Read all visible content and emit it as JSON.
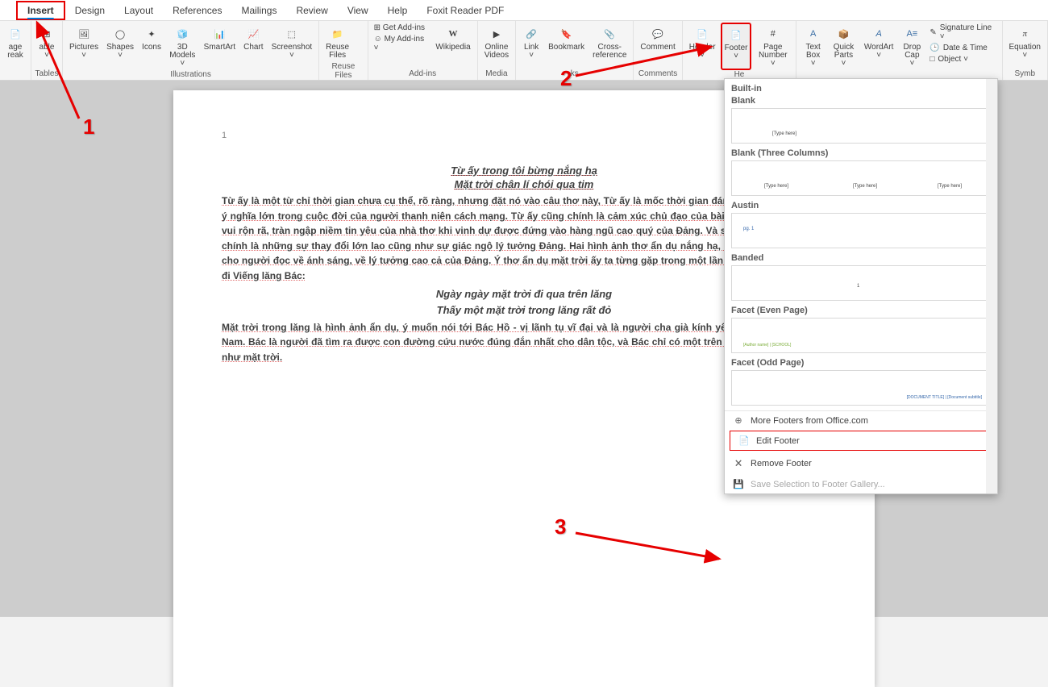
{
  "tabs": [
    "Insert",
    "Design",
    "Layout",
    "References",
    "Mailings",
    "Review",
    "View",
    "Help",
    "Foxit Reader PDF"
  ],
  "active_tab": 0,
  "ribbon_groups": {
    "pages": {
      "label": "",
      "items": [
        {
          "l": "age\nreak"
        }
      ]
    },
    "tables": {
      "label": "Tables",
      "items": [
        {
          "l": "able\n ˅"
        }
      ]
    },
    "illus": {
      "label": "Illustrations",
      "items": [
        {
          "l": "Pictures\n ˅"
        },
        {
          "l": "Shapes\n ˅"
        },
        {
          "l": "Icons"
        },
        {
          "l": "3D\nModels ˅"
        },
        {
          "l": "SmartArt"
        },
        {
          "l": "Chart"
        },
        {
          "l": "Screenshot\n ˅"
        }
      ]
    },
    "reuse": {
      "label": "Reuse Files",
      "items": [
        {
          "l": "Reuse\nFiles"
        }
      ]
    },
    "addins": {
      "label": "Add-ins",
      "items_sm": [
        "⊞ Get Add-ins",
        "☺ My Add-ins ˅"
      ],
      "items": [
        {
          "l": "Wikipedia"
        }
      ]
    },
    "media": {
      "label": "Media",
      "items": [
        {
          "l": "Online\nVideos"
        }
      ]
    },
    "links": {
      "label": "ks",
      "items": [
        {
          "l": "Link\n ˅"
        },
        {
          "l": "Bookmark"
        },
        {
          "l": "Cross-\nreference"
        }
      ]
    },
    "comments": {
      "label": "Comments",
      "items": [
        {
          "l": "Comment"
        }
      ]
    },
    "hf": {
      "label": "He",
      "items": [
        {
          "l": "Header\n ˅"
        },
        {
          "l": "Footer\n ˅"
        },
        {
          "l": "Page\nNumber ˅"
        }
      ]
    },
    "text": {
      "label": "",
      "items": [
        {
          "l": "Text\nBox ˅"
        },
        {
          "l": "Quick\nParts ˅"
        },
        {
          "l": "WordArt\n ˅"
        },
        {
          "l": "Drop\nCap ˅"
        }
      ],
      "sm": [
        "Signature Line ˅",
        "Date & Time",
        "Object ˅"
      ]
    },
    "sym": {
      "label": "Symb",
      "items": [
        {
          "l": "Equation\n ˅"
        }
      ]
    }
  },
  "doc": {
    "page_num": "1",
    "t1": "Từ ấy trong tôi bừng nắng hạ",
    "t2": "Mặt trời chân lí chói qua tim",
    "p1": "Từ ấy là một từ chỉ thời gian chưa cụ thể, rõ ràng, nhưng đặt nó vào câu thơ này, Từ ấy là mốc thời gian đánh dấu bước ngoặt có ý nghĩa lớn trong cuộc đời của người thanh niên cách mạng. Từ ấy cũng chính là cảm xúc chủ đạo của bài thơ: là tiếng lòng reo vui rộn rã, tràn ngập niềm tin yêu của nhà thơ khi vinh dự được đứng vào hàng ngũ cao quý của Đảng. Và sau thời gian Từ ấy đó chính là những sự thay đổi lớn lao cũng như sự giác ngộ lý tưởng Đảng. Hai hình ảnh thơ ẩn dụ nắng hạ, mặt trời chân lí gợi ra cho người đọc về ánh sáng, về lý tưởng cao cả của Đảng. Ý thơ ẩn dụ mặt trời ấy ta từng gặp trong một lần nhà thơ Viễn Phương đi Viếng lăng Bác:",
    "q1": "Ngày ngày mặt trời đi qua trên lăng",
    "q2": "Thấy một mặt trời trong lăng rất đỏ",
    "p2": "Mặt trời trong lăng là hình ảnh ẩn dụ, ý muốn nói tới Bác Hồ - vị lãnh tụ vĩ đại và là người cha già kính yêu của cả dân tộc Việt Nam. Bác là người đã tìm ra được con đường cứu nước đúng đắn nhất cho dân tộc, và Bác chỉ có một trên đời nên Bác được coi như mặt trời."
  },
  "gallery": {
    "heads": {
      "h1": "Built-in",
      "h2": "Blank",
      "h3": "Blank (Three Columns)",
      "h4": "Austin",
      "h5": "Banded",
      "h6": "Facet (Even Page)",
      "h7": "Facet (Odd Page)"
    },
    "ph": "[Type here]",
    "auth_ph": "[Author name] | [SCHOOL]",
    "dt_ph": "[DOCUMENT TITLE] | [Document subtitle]",
    "footer": {
      "more": "More Footers from Office.com",
      "edit": "Edit Footer",
      "remove": "Remove Footer",
      "save": "Save Selection to Footer Gallery..."
    }
  },
  "markers": {
    "m1": "1",
    "m2": "2",
    "m3": "3"
  }
}
